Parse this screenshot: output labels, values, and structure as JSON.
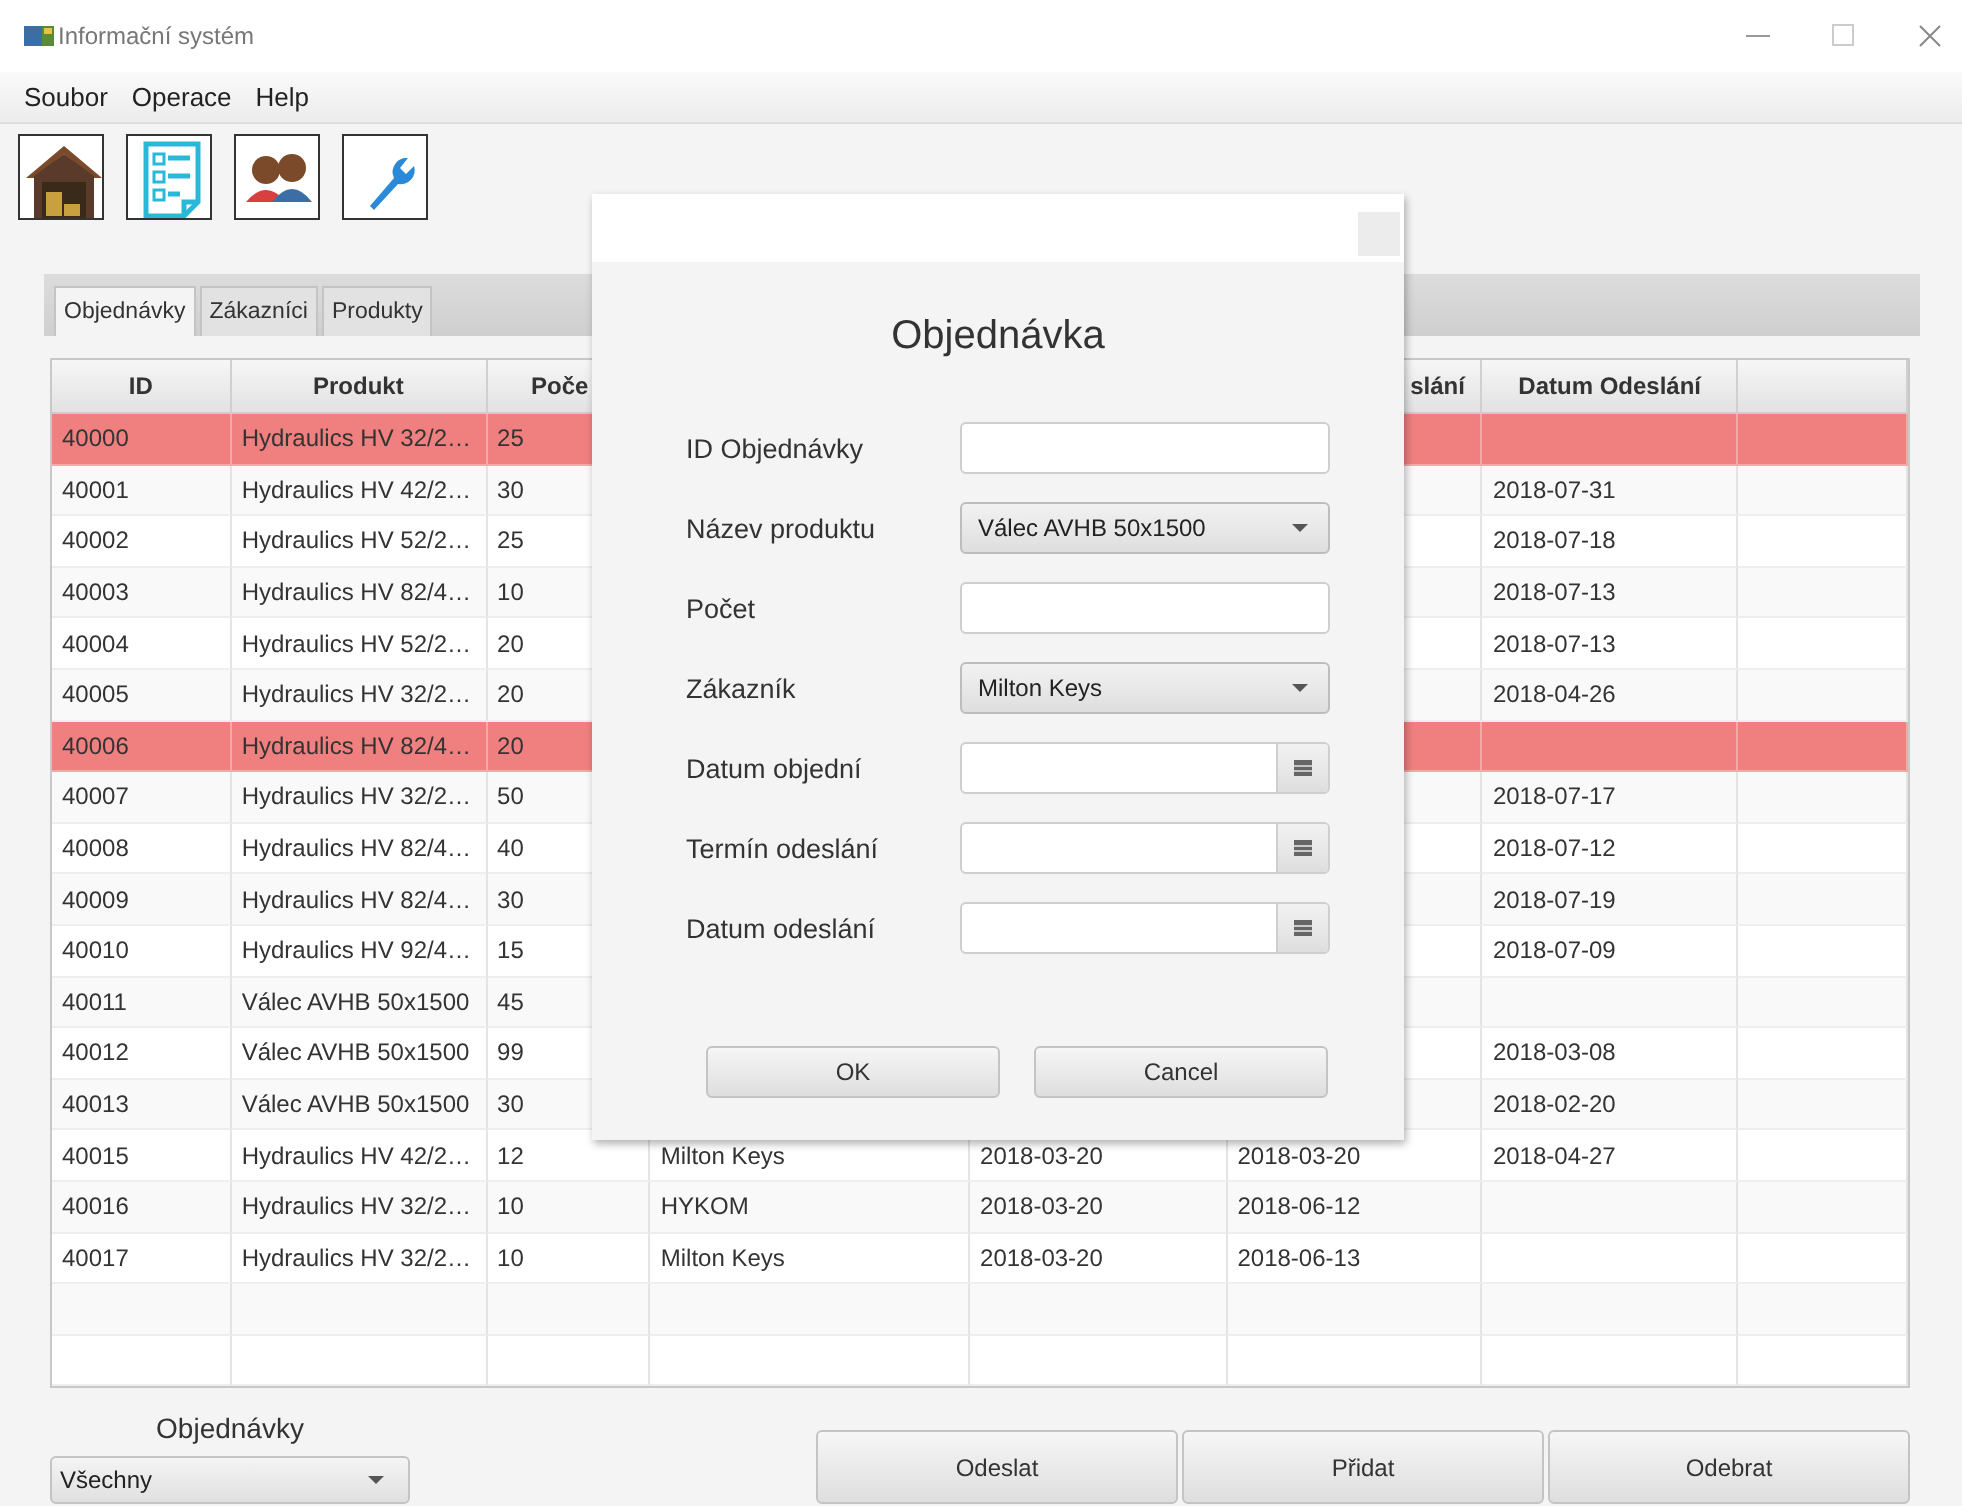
{
  "window": {
    "title": "Informační systém"
  },
  "menu": [
    "Soubor",
    "Operace",
    "Help"
  ],
  "toolbar": [
    {
      "kind": "warehouse"
    },
    {
      "kind": "checklist"
    },
    {
      "kind": "people"
    },
    {
      "kind": "wrench"
    }
  ],
  "tabs": [
    {
      "label": "Objednávky",
      "selected": true
    },
    {
      "label": "Zákazníci",
      "selected": false
    },
    {
      "label": "Produkty",
      "selected": false
    }
  ],
  "table": {
    "columns": {
      "id": "ID",
      "product": "Produkt",
      "column_3": "Poče",
      "column_6": "slání",
      "ship_date": "Datum Odeslání"
    },
    "rows": [
      {
        "id": "40000",
        "product": "Hydraulics HV 32/2…",
        "column_3": "25",
        "highlighted": true
      },
      {
        "id": "40001",
        "product": "Hydraulics HV 42/2…",
        "column_3": "30",
        "ship_date": "2018-07-31",
        "highlighted": false
      },
      {
        "id": "40002",
        "product": "Hydraulics HV 52/2…",
        "column_3": "25",
        "ship_date": "2018-07-18",
        "highlighted": false
      },
      {
        "id": "40003",
        "product": "Hydraulics HV 82/4…",
        "column_3": "10",
        "ship_date": "2018-07-13",
        "highlighted": false
      },
      {
        "id": "40004",
        "product": "Hydraulics HV 52/2…",
        "column_3": "20",
        "ship_date": "2018-07-13",
        "highlighted": false
      },
      {
        "id": "40005",
        "product": "Hydraulics HV 32/2…",
        "column_3": "20",
        "ship_date": "2018-04-26",
        "highlighted": false
      },
      {
        "id": "40006",
        "product": "Hydraulics HV 82/4…",
        "column_3": "20",
        "highlighted": true
      },
      {
        "id": "40007",
        "product": "Hydraulics HV 32/2…",
        "column_3": "50",
        "ship_date": "2018-07-17",
        "highlighted": false
      },
      {
        "id": "40008",
        "product": "Hydraulics HV 82/4…",
        "column_3": "40",
        "ship_date": "2018-07-12",
        "highlighted": false
      },
      {
        "id": "40009",
        "product": "Hydraulics HV 82/4…",
        "column_3": "30",
        "ship_date": "2018-07-19",
        "highlighted": false
      },
      {
        "id": "40010",
        "product": "Hydraulics HV 92/4…",
        "column_3": "15",
        "ship_date": "2018-07-09",
        "highlighted": false
      },
      {
        "id": "40011",
        "product": "Válec AVHB 50x1500",
        "column_3": "45",
        "highlighted": false
      },
      {
        "id": "40012",
        "product": "Válec AVHB 50x1500",
        "column_3": "99",
        "ship_date": "2018-03-08",
        "highlighted": false
      },
      {
        "id": "40013",
        "product": "Válec AVHB 50x1500",
        "column_3": "30",
        "ship_date": "2018-02-20",
        "highlighted": false
      },
      {
        "id": "40015",
        "product": "Hydraulics HV 42/2…",
        "column_3": "12",
        "column_4": "Milton Keys",
        "column_5": "2018-03-20",
        "column_6": "2018-03-20",
        "ship_date": "2018-04-27",
        "highlighted": false
      },
      {
        "id": "40016",
        "product": "Hydraulics HV 32/2…",
        "column_3": "10",
        "column_4": "HYKOM",
        "column_5": "2018-03-20",
        "column_6": "2018-06-12",
        "highlighted": false
      },
      {
        "id": "40017",
        "product": "Hydraulics HV 32/2…",
        "column_3": "10",
        "column_4": "Milton Keys",
        "column_5": "2018-03-20",
        "column_6": "2018-06-13",
        "highlighted": false
      }
    ]
  },
  "dialog": {
    "title": "Objednávka",
    "fields": [
      {
        "label": "ID Objednávky",
        "kind": "text"
      },
      {
        "label": "Název produktu",
        "kind": "select",
        "value": "Válec AVHB 50x1500"
      },
      {
        "label": "Počet",
        "kind": "text"
      },
      {
        "label": "Zákazník",
        "kind": "select",
        "value": "Milton Keys"
      },
      {
        "label": "Datum objední",
        "kind": "date"
      },
      {
        "label": "Termín odeslání",
        "kind": "date"
      },
      {
        "label": "Datum odeslání",
        "kind": "date"
      }
    ],
    "buttons": [
      "OK",
      "Cancel"
    ]
  },
  "filter": {
    "label": "Objednávky",
    "value": "Všechny"
  },
  "actions": [
    "Odeslat",
    "Přidat",
    "Odebrat"
  ]
}
